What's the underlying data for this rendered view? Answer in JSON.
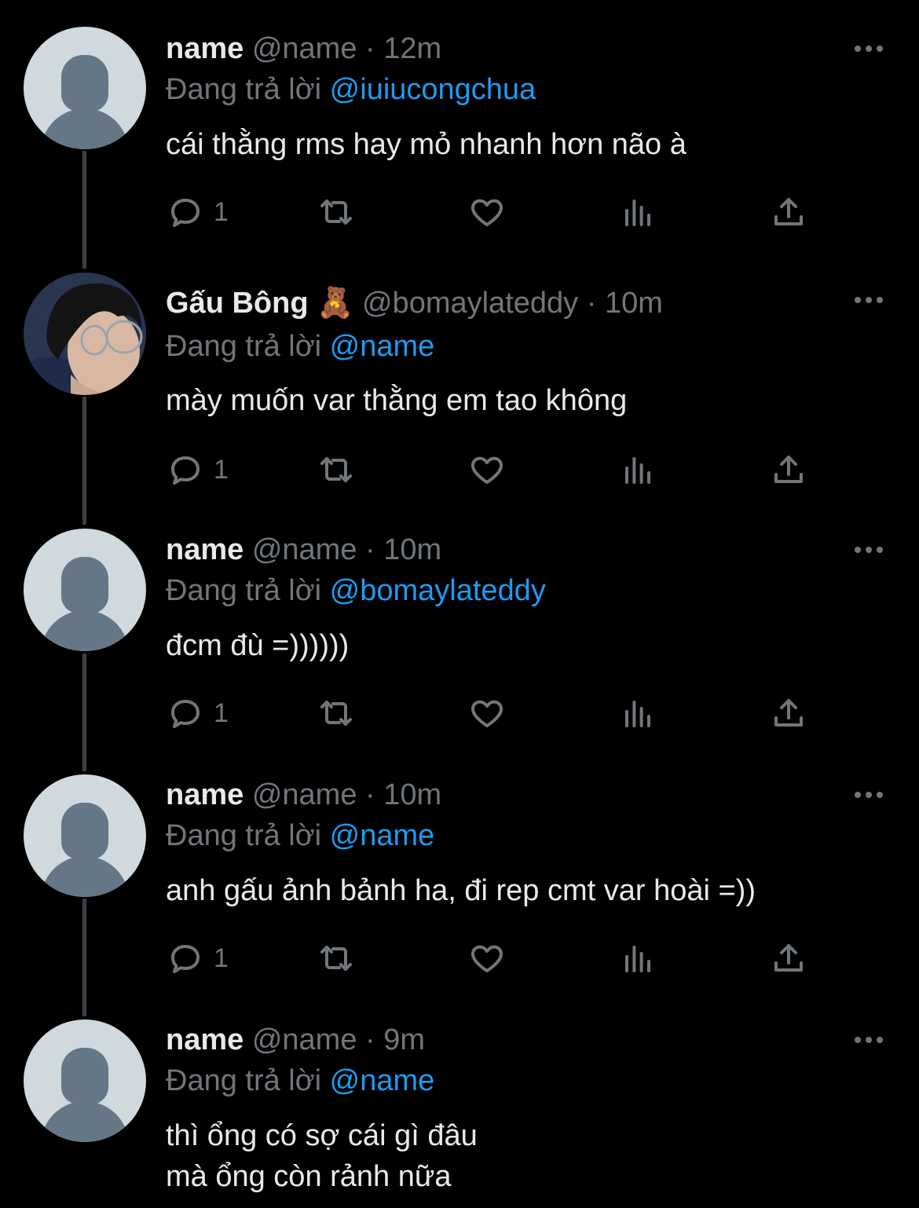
{
  "tweets": [
    {
      "name": "name",
      "handle": "@name",
      "dot": "·",
      "time": "12m",
      "reply_prefix": "Đang trả lời",
      "reply_to": "@iuiucongchua",
      "text": "cái thằng rms hay mỏ nhanh hơn não à",
      "reply_count": "1",
      "avatar": "default-avatar"
    },
    {
      "name": "Gấu Bông 🧸",
      "handle": "@bomaylateddy",
      "dot": "·",
      "time": "10m",
      "reply_prefix": "Đang trả lời",
      "reply_to": "@name",
      "text": "mày muốn var thằng em tao không",
      "reply_count": "1",
      "avatar": "photo-avatar"
    },
    {
      "name": "name",
      "handle": "@name",
      "dot": "·",
      "time": "10m",
      "reply_prefix": "Đang trả lời",
      "reply_to": "@bomaylateddy",
      "text": "đcm đù =))))))",
      "reply_count": "1",
      "avatar": "default-avatar"
    },
    {
      "name": "name",
      "handle": "@name",
      "dot": "·",
      "time": "10m",
      "reply_prefix": "Đang trả lời",
      "reply_to": "@name",
      "text": "anh gấu ảnh bảnh ha, đi rep cmt var hoài =))",
      "reply_count": "1",
      "avatar": "default-avatar"
    },
    {
      "name": "name",
      "handle": "@name",
      "dot": "·",
      "time": "9m",
      "reply_prefix": "Đang trả lời",
      "reply_to": "@name",
      "text": "thì ổng có sợ cái gì đâu\nmà ổng còn rảnh nữa",
      "reply_count": "",
      "avatar": "default-avatar"
    }
  ],
  "icons": {
    "reply": "reply-icon",
    "retweet": "retweet-icon",
    "like": "like-icon",
    "views": "views-icon",
    "share": "share-icon",
    "more": "more-icon"
  },
  "colors": {
    "background": "#000000",
    "text": "#e7e9ea",
    "muted": "#71767b",
    "mention": "#1d9bf0",
    "avatar_bg": "#cfd9de",
    "avatar_fg": "#657786"
  }
}
